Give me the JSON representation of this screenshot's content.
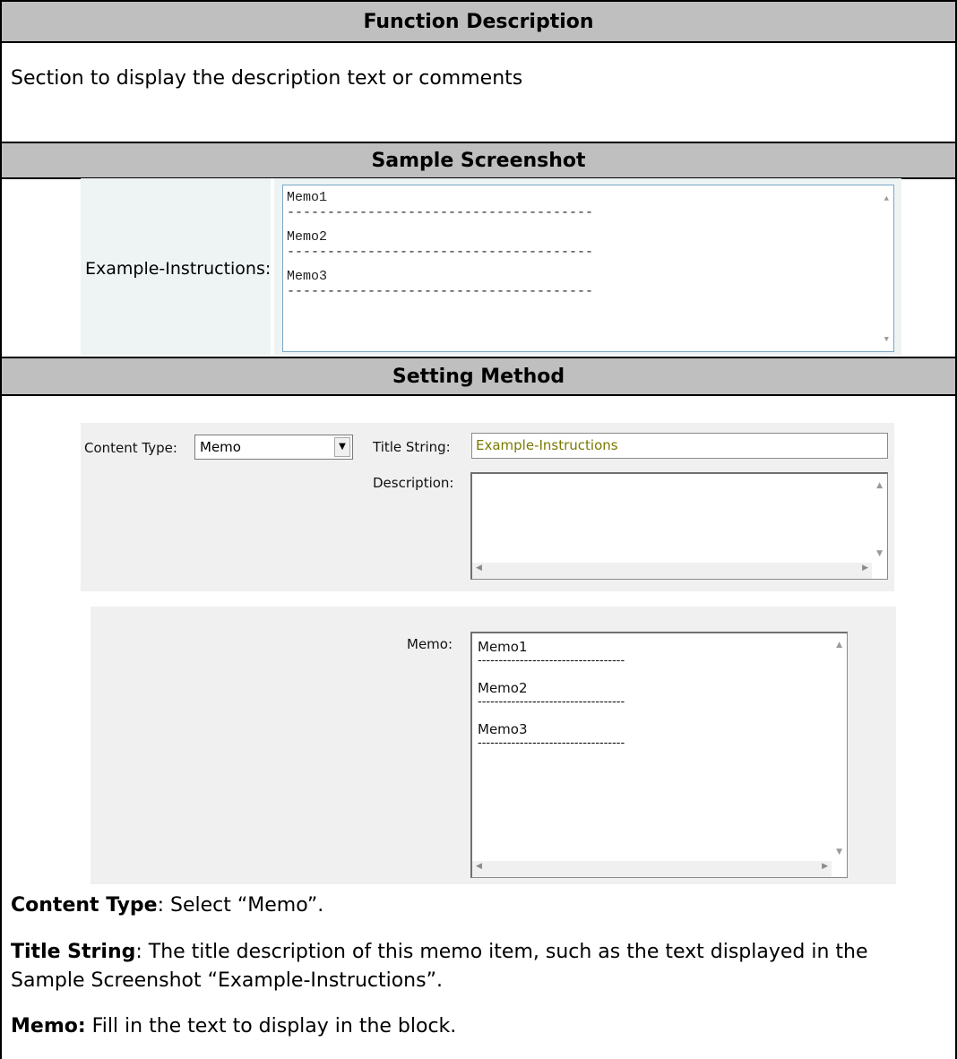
{
  "sections": {
    "function_description": "Function Description",
    "sample_screenshot": "Sample Screenshot",
    "setting_method": "Setting Method"
  },
  "function_text": "Section to display the description text or comments",
  "sample": {
    "label": "Example-Instructions:",
    "memo_lines": [
      "Memo1",
      "Memo2",
      "Memo3"
    ],
    "separator": "--------------------------------------"
  },
  "settings": {
    "content_type_label": "Content Type:",
    "content_type_value": "Memo",
    "title_string_label": "Title String:",
    "title_string_value": "Example-Instructions",
    "description_label": "Description:",
    "description_value": "",
    "memo_label": "Memo:",
    "memo_lines": [
      "Memo1",
      "Memo2",
      "Memo3"
    ],
    "separator": "-----------------------------------"
  },
  "explanations": {
    "content_type_term": "Content Type",
    "content_type_text": ": Select “Memo”.",
    "title_string_term": "Title String",
    "title_string_text": ": The title description of this memo item, such as the text displayed in the Sample Screenshot “Example-Instructions”.",
    "memo_term": "Memo:",
    "memo_text": " Fill in the text to display in the block."
  }
}
